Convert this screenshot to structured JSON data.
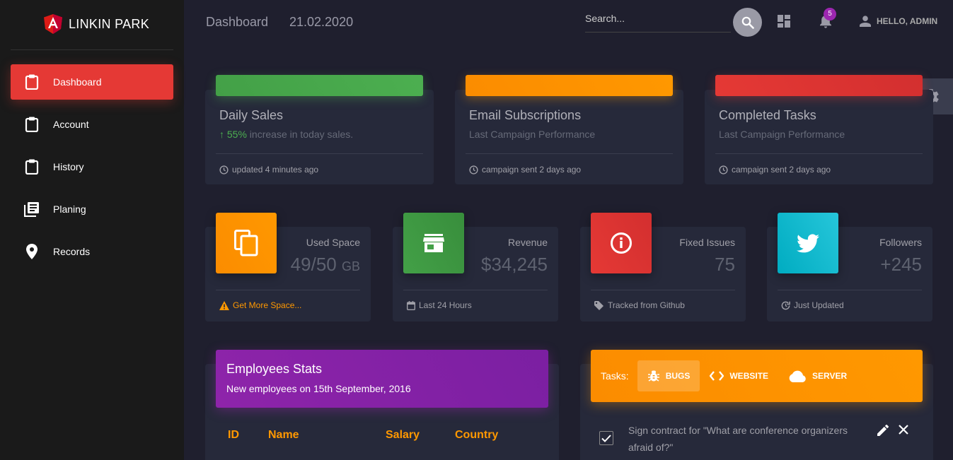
{
  "brand": {
    "name": "LINKIN PARK"
  },
  "sidebar": {
    "items": [
      {
        "label": "Dashboard",
        "icon": "clipboard-icon",
        "active": true
      },
      {
        "label": "Account",
        "icon": "clipboard-icon"
      },
      {
        "label": "History",
        "icon": "clipboard-icon"
      },
      {
        "label": "Planing",
        "icon": "library-books-icon"
      },
      {
        "label": "Records",
        "icon": "location-pin-icon"
      }
    ]
  },
  "header": {
    "title": "Dashboard",
    "date": "21.02.2020",
    "search_placeholder": "Search...",
    "notification_count": "5",
    "user_label": "HELLO, ADMIN"
  },
  "summary_cards": [
    {
      "title": "Daily Sales",
      "subtitle_percent": "55%",
      "subtitle_rest": " increase in today sales.",
      "footer": "updated 4 minutes ago",
      "color": "#43a047"
    },
    {
      "title": "Email Subscriptions",
      "subtitle": "Last Campaign Performance",
      "footer": "campaign sent 2 days ago",
      "color": "#fb8c00"
    },
    {
      "title": "Completed Tasks",
      "subtitle": "Last Campaign Performance",
      "footer": "campaign sent 2 days ago",
      "color": "#e53935"
    }
  ],
  "stat_cards": [
    {
      "category": "Used Space",
      "value": "49/50",
      "unit": "GB",
      "footer": "Get More Space...",
      "icon": "copy-icon",
      "color": "#fb8c00"
    },
    {
      "category": "Revenue",
      "value": "$34,245",
      "footer": "Last 24 Hours",
      "icon": "store-icon",
      "color": "#43a047"
    },
    {
      "category": "Fixed Issues",
      "value": "75",
      "footer": "Tracked from Github",
      "icon": "info-icon",
      "color": "#e53935"
    },
    {
      "category": "Followers",
      "value": "+245",
      "footer": "Just Updated",
      "icon": "twitter-icon",
      "color": "#00acc1"
    }
  ],
  "employees": {
    "title": "Employees Stats",
    "subtitle": "New employees on 15th September, 2016",
    "columns": [
      "ID",
      "Name",
      "Salary",
      "Country"
    ]
  },
  "tasks": {
    "label": "Tasks:",
    "tabs": [
      {
        "label": "BUGS",
        "icon": "bug-icon",
        "active": true
      },
      {
        "label": "WEBSITE",
        "icon": "code-icon"
      },
      {
        "label": "SERVER",
        "icon": "cloud-icon"
      }
    ],
    "items": [
      {
        "text": "Sign contract for \"What are conference organizers afraid of?\"",
        "checked": true
      }
    ]
  }
}
